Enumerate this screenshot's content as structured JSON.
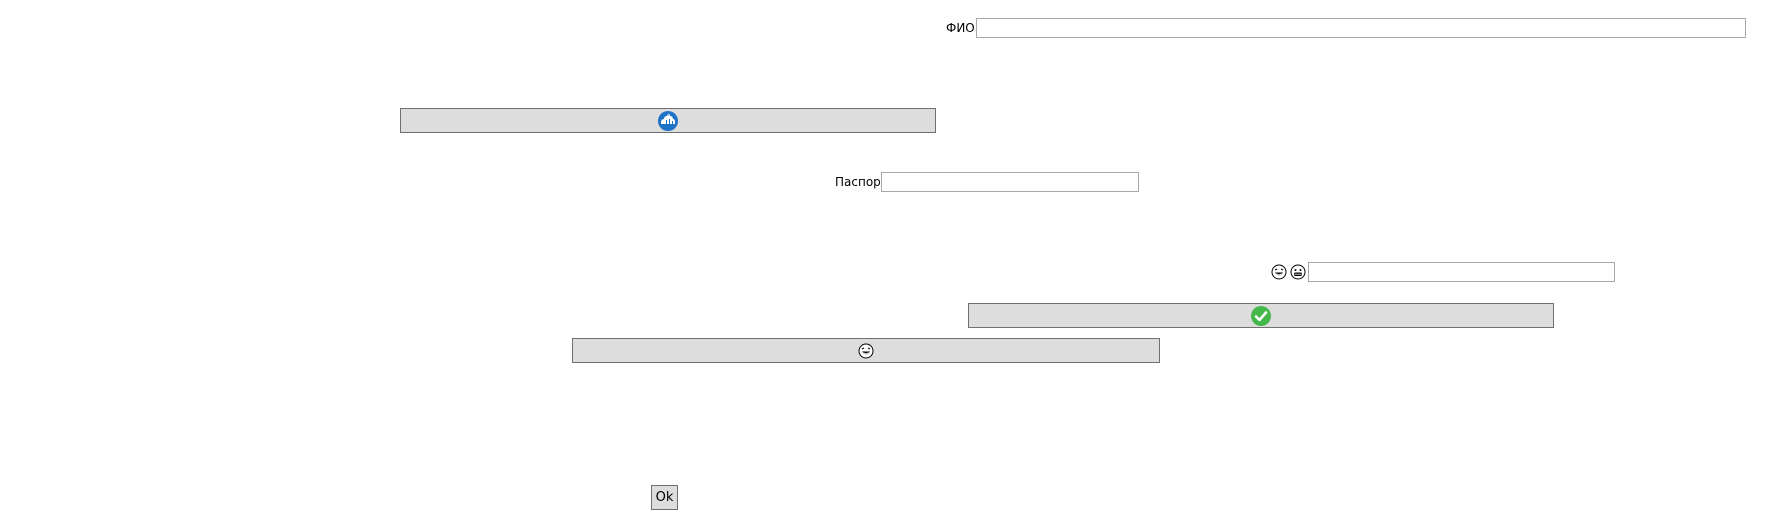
{
  "form": {
    "fio": {
      "label": "ФИО",
      "value": ""
    },
    "passport": {
      "label": "Паспорт",
      "value": ""
    },
    "emoji_field": {
      "value": "",
      "icons": [
        "laughing-face-icon",
        "grinning-face-icon"
      ]
    }
  },
  "buttons": {
    "cloud_button": {
      "icon": "cloud-icon",
      "icon_color": "#1e73c8"
    },
    "check_button": {
      "icon": "check-circle-icon",
      "icon_color": "#44b84a"
    },
    "emoji_button": {
      "icon": "laughing-face-icon"
    },
    "ok_button": {
      "label": "Ok"
    }
  },
  "colors": {
    "button_bg": "#dddddd",
    "button_border": "#707070",
    "input_border": "#a8a8a8"
  }
}
